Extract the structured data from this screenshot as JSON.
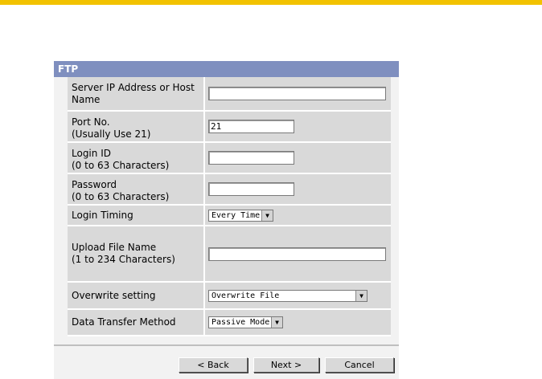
{
  "panel": {
    "title": "FTP"
  },
  "fields": {
    "server": {
      "label1": "Server IP Address or Host",
      "label2": "Name",
      "value": ""
    },
    "port": {
      "label1": "Port No.",
      "label2": "(Usually Use 21)",
      "value": "21"
    },
    "login_id": {
      "label1": "Login ID",
      "label2": "(0 to 63 Characters)",
      "value": ""
    },
    "password": {
      "label1": "Password",
      "label2": "(0 to 63 Characters)",
      "value": ""
    },
    "login_timing": {
      "label": "Login Timing",
      "selected": "Every Time"
    },
    "upload_file": {
      "label1": "Upload File Name",
      "label2": "(1 to 234 Characters)",
      "value": ""
    },
    "overwrite": {
      "label": "Overwrite setting",
      "selected": "Overwrite File"
    },
    "transfer": {
      "label": "Data Transfer Method",
      "selected": "Passive Mode"
    }
  },
  "buttons": {
    "back": "< Back",
    "next": "Next >",
    "cancel": "Cancel"
  },
  "colors": {
    "top_bar": "#f2c200",
    "header": "#7f8fbf",
    "row_bg": "#d9d9d9"
  },
  "icons": {
    "dropdown": "chevron-down-icon"
  }
}
